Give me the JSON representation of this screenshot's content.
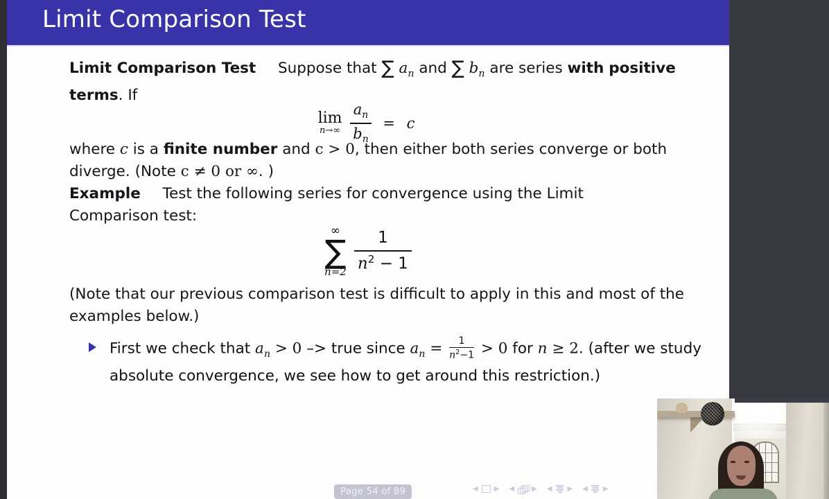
{
  "window": {
    "background_color": "#383840",
    "letterbox_color": "#2e2e33"
  },
  "slide": {
    "title": "Limit Comparison Test",
    "header_color": "#3833a8",
    "background_color": "#fdfdfd",
    "text_color": "#15151a",
    "bullet_color": "#3833a8",
    "theorem": {
      "name": "Limit Comparison Test",
      "statement_part1": "Suppose that",
      "sum_a": "∑",
      "var_a": "a",
      "var_a_sub": "n",
      "statement_and": "and",
      "sum_b": "∑",
      "var_b": "b",
      "var_b_sub": "n",
      "statement_part2": "are series",
      "emph_with": "with",
      "emph_positive_terms": "positive terms",
      "statement_part3": ". If"
    },
    "equation_limit": {
      "lim_operator": "lim",
      "lim_subscript": "n→∞",
      "numerator": "a",
      "numerator_sub": "n",
      "denominator": "b",
      "denominator_sub": "n",
      "equals": "=",
      "result": "c"
    },
    "condition": {
      "part1": "where",
      "var_c": "c",
      "part2": "is a",
      "emph_finite": "finite number",
      "part3": "and",
      "inequality": "c > 0",
      "part4": ", then either both series converge or both diverge. (Note",
      "note_ne": "c ≠ 0 or ∞",
      "part5": ". )"
    },
    "example": {
      "label": "Example",
      "text": "Test the following series for convergence using the Limit Comparison test:"
    },
    "equation_series": {
      "sum_upper": "∞",
      "sum_glyph": "∑",
      "sum_lower": "n=2",
      "numerator": "1",
      "denominator_base": "n",
      "denominator_exp": "2",
      "denominator_rest": "− 1"
    },
    "note": {
      "text": "(Note that our previous comparison test is difficult to apply in this and most of the examples below.)"
    },
    "bullets": [
      {
        "marker": "▶",
        "part1": "First we check that",
        "var_a": "a",
        "var_a_sub": "n",
        "gt_zero": "> 0",
        "arrow": "–>",
        "part2": "true since",
        "var_a2": "a",
        "var_a2_sub": "n",
        "equals": "=",
        "frac_num": "1",
        "frac_den_base": "n",
        "frac_den_exp": "2",
        "frac_den_rest": "−1",
        "gt_zero2": "> 0",
        "part3": "for",
        "var_n": "n",
        "n_cond": "≥ 2",
        "part4": ". (after we study absolute convergence, we see how to get around this restriction.)"
      }
    ]
  },
  "footer": {
    "page_label": "Page 54 of 89",
    "page_badge_color": "#c3c3d2",
    "nav_color": "#cbcbdd",
    "nav_groups": [
      {
        "name": "slide-navigation",
        "left_arrow": "◀",
        "icon": "slide-icon",
        "right_arrow": "▶"
      },
      {
        "name": "frame-navigation",
        "left_arrow": "◀",
        "icon": "frames-icon",
        "right_arrow": "▶"
      },
      {
        "name": "subsection-navigation",
        "left_arrow": "◀",
        "icon": "subsection-icon",
        "right_arrow": "▶"
      },
      {
        "name": "section-navigation",
        "left_arrow": "◀",
        "icon": "section-icon",
        "right_arrow": "▶"
      }
    ]
  },
  "webcam": {
    "description": "presenter webcam overlay"
  }
}
